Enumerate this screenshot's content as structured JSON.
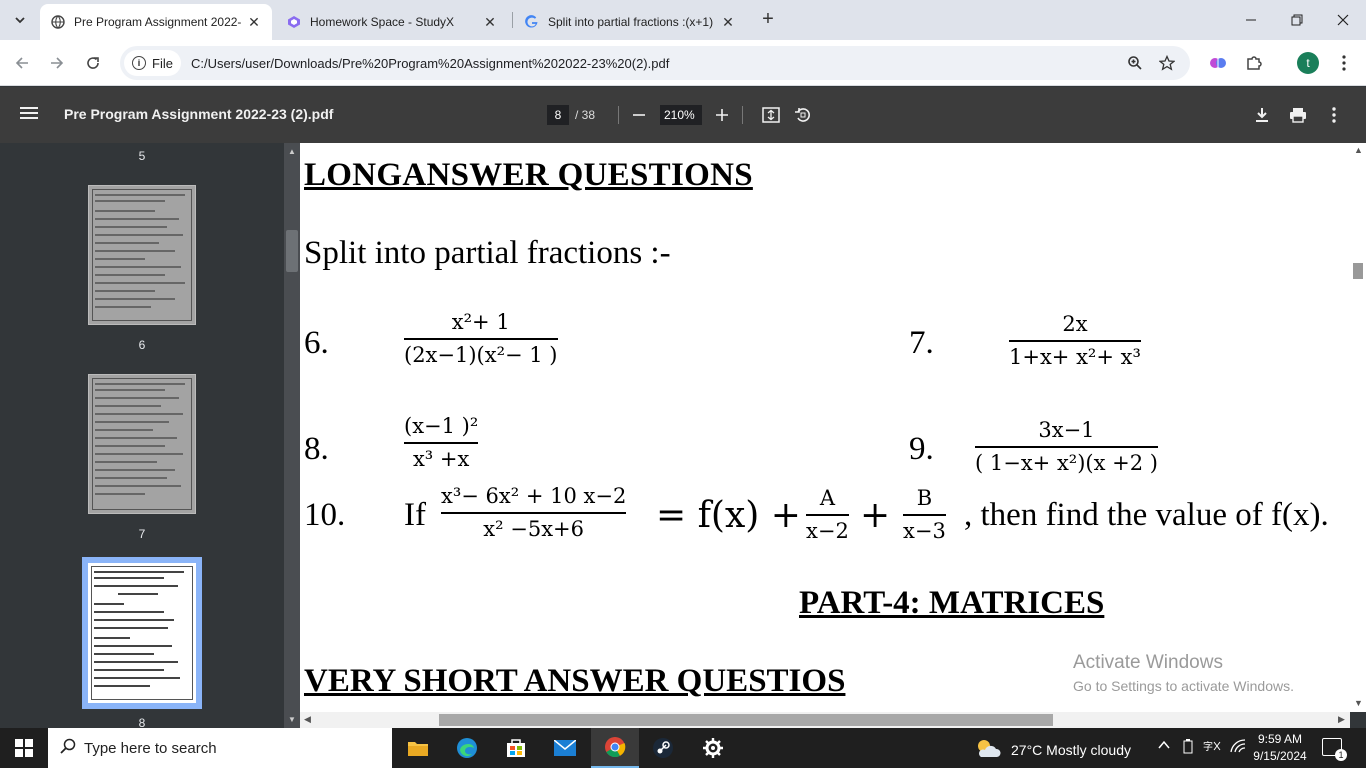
{
  "browser": {
    "tabs": [
      {
        "title": "Pre Program Assignment 2022-",
        "active": true
      },
      {
        "title": "Homework Space - StudyX",
        "active": false
      },
      {
        "title": "Split into partial fractions :(x+1)",
        "active": false
      }
    ],
    "file_chip": "File",
    "url": "C:/Users/user/Downloads/Pre%20Program%20Assignment%202022-23%20(2).pdf",
    "profile_initial": "t"
  },
  "pdf_toolbar": {
    "doc_title": "Pre Program Assignment 2022-23 (2).pdf",
    "current_page": "8",
    "total_pages": "/ 38",
    "zoom": "210%"
  },
  "sidebar": {
    "thumb_labels": [
      "5",
      "6",
      "7",
      "8"
    ],
    "selected": "8"
  },
  "document": {
    "heading_long": "LONGANSWER QUESTIONS",
    "split_text": "Split into partial fractions :-",
    "q6": {
      "num": "6.",
      "numerator": "x²+ 1",
      "denominator": "(2x−1)(x²− 1 )"
    },
    "q7": {
      "num": "7.",
      "numerator": "2x",
      "denominator": "1+x+ x²+ x³"
    },
    "q8": {
      "num": "8.",
      "numerator": "(x−1 )²",
      "denominator": "x³ +x"
    },
    "q9": {
      "num": "9.",
      "numerator": "3x−1",
      "denominator": "( 1−x+ x²)(x +2 )"
    },
    "q10": {
      "num": "10.",
      "if": "If",
      "numerator": "x³− 6x² + 10 x−2",
      "denominator": "x² −5x+6",
      "eq": "= f(x) +",
      "a_num": "A",
      "a_den": "x−2",
      "plus": "+",
      "b_num": "B",
      "b_den": "x−3",
      "tail": ", then find the value of f(x)."
    },
    "heading_part": "PART-4: MATRICES",
    "heading_vs": "VERY SHORT ANSWER QUESTIOS"
  },
  "watermark": {
    "line1": "Activate Windows",
    "line2": "Go to Settings to activate Windows."
  },
  "taskbar": {
    "search_placeholder": "Type here to search",
    "weather": "27°C  Mostly cloudy",
    "time": "9:59 AM",
    "date": "9/15/2024",
    "notification_count": "1"
  }
}
